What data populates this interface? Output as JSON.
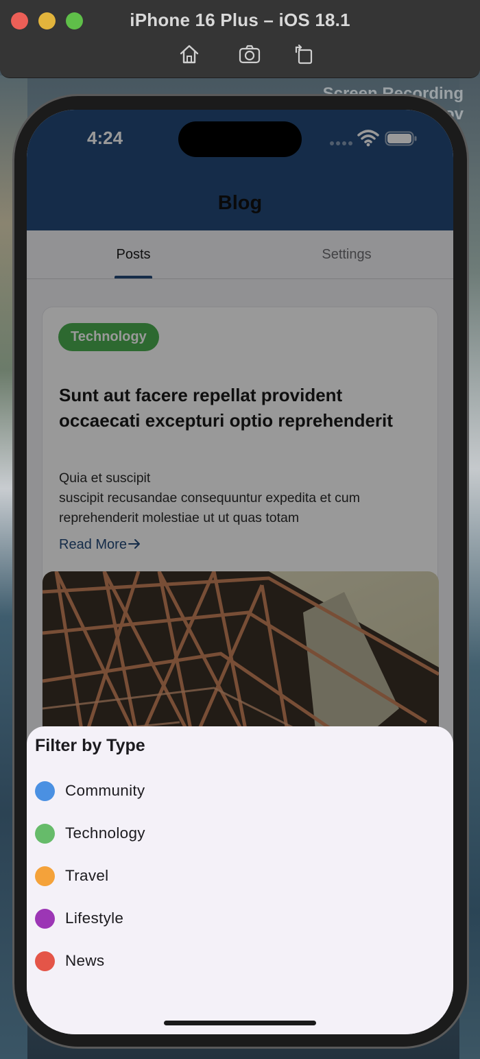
{
  "simulator": {
    "title": "iPhone 16 Plus – iOS 18.1",
    "toolbar": [
      "home-icon",
      "screenshot-icon",
      "rotate-icon"
    ],
    "overlay_text": [
      "Screen Recording",
      "ov"
    ]
  },
  "status_bar": {
    "time": "4:24"
  },
  "app": {
    "title": "Blog",
    "tabs": [
      {
        "label": "Posts",
        "selected": true
      },
      {
        "label": "Settings",
        "selected": false
      }
    ]
  },
  "post": {
    "category": "Technology",
    "category_color": "#4caf50",
    "title": "Sunt aut facere repellat provident occaecati excepturi optio reprehenderit",
    "body": "Quia et suscipit\nsuscipit recusandae consequuntur expedita et cum reprehenderit molestiae ut ut quas totam",
    "read_more": "Read More",
    "read_more_icon": "arrow-right-icon"
  },
  "filter_sheet": {
    "title": "Filter by Type",
    "options": [
      {
        "label": "Community",
        "color": "#4a90e2"
      },
      {
        "label": "Technology",
        "color": "#66bb6a"
      },
      {
        "label": "Travel",
        "color": "#f4a23a"
      },
      {
        "label": "Lifestyle",
        "color": "#9c36b5"
      },
      {
        "label": "News",
        "color": "#e45548"
      }
    ]
  },
  "colors": {
    "primary": "#234a7a",
    "sheet_background": "#f4f1f8"
  }
}
